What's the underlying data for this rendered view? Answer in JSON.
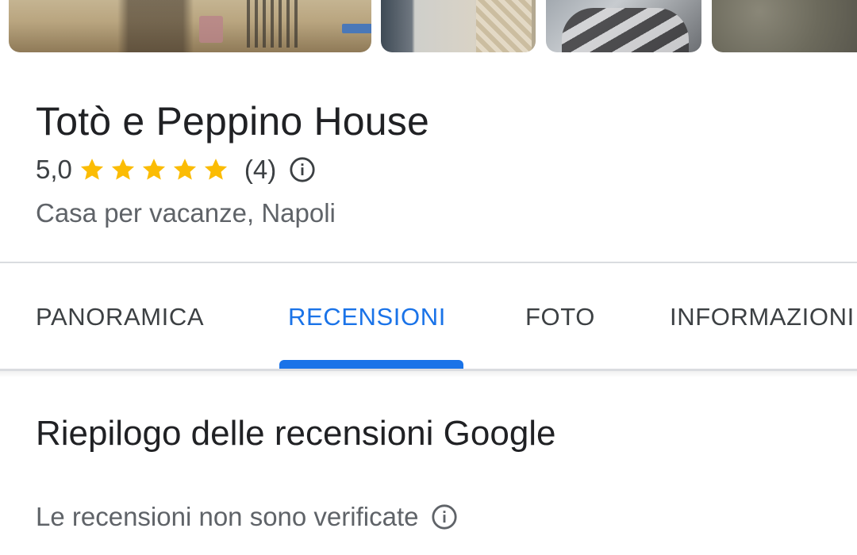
{
  "place": {
    "name": "Totò e Peppino House",
    "rating": "5,0",
    "stars": 5,
    "review_count": "(4)",
    "category": "Casa per vacanze, Napoli"
  },
  "tabs": [
    {
      "label": "PANORAMICA",
      "active": false
    },
    {
      "label": "RECENSIONI",
      "active": true
    },
    {
      "label": "FOTO",
      "active": false
    },
    {
      "label": "INFORMAZIONI",
      "active": false
    }
  ],
  "reviews": {
    "summary_title": "Riepilogo delle recensioni Google",
    "unverified_note": "Le recensioni non sono verificate"
  },
  "icons": {
    "star": "star-icon",
    "info": "info-icon"
  },
  "colors": {
    "star": "#fbbc04",
    "accent": "#1a73e8",
    "text_primary": "#202124",
    "text_secondary": "#5f6368",
    "divider": "#dadce0"
  }
}
